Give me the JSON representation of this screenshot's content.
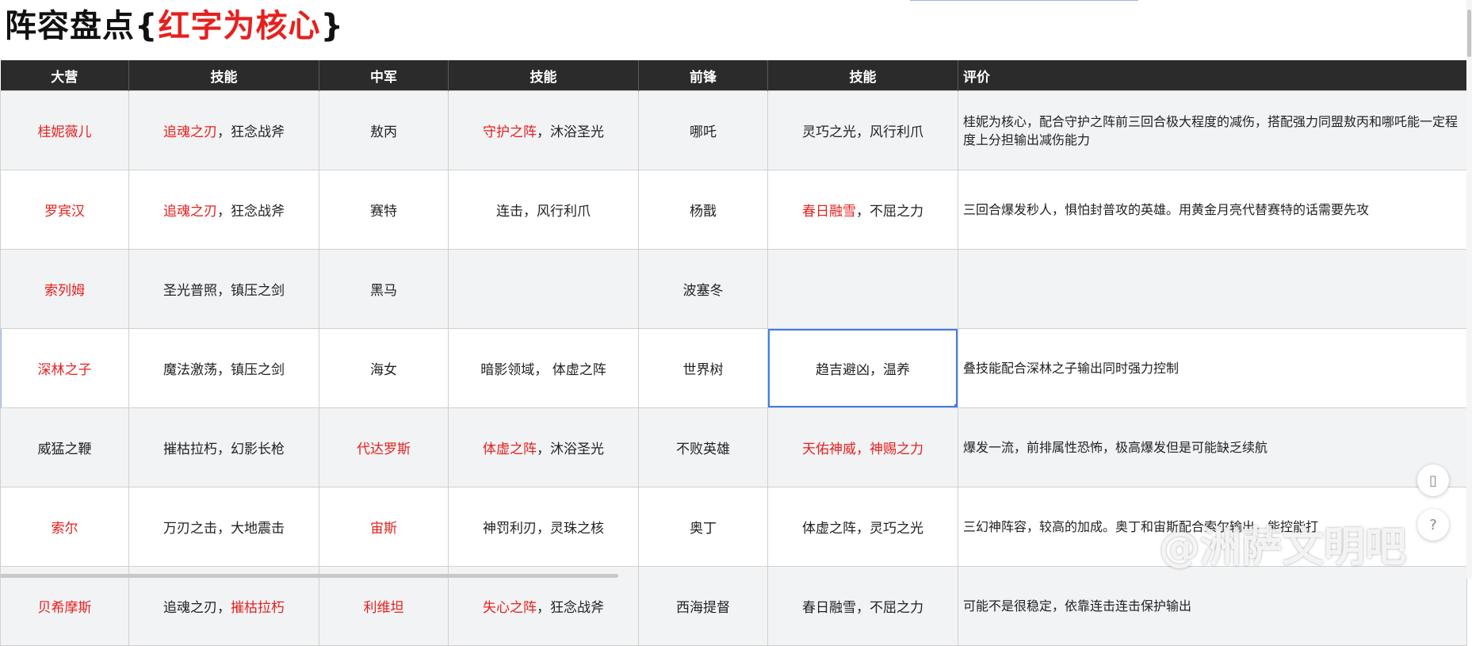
{
  "title": {
    "main": "阵容盘点{",
    "highlight": "红字为核心",
    "end": "}"
  },
  "headers": [
    "大营",
    "技能",
    "中军",
    "技能",
    "前锋",
    "技能",
    "评价"
  ],
  "rows": [
    {
      "c0": [
        {
          "t": "桂妮薇儿",
          "red": true
        }
      ],
      "c1": [
        {
          "t": "追魂之刃",
          "red": true
        },
        {
          "t": "，狂念战斧",
          "red": false
        }
      ],
      "c2": [
        {
          "t": "敖丙",
          "red": false
        }
      ],
      "c3": [
        {
          "t": "守护之阵",
          "red": true
        },
        {
          "t": "，沐浴圣光",
          "red": false
        }
      ],
      "c4": [
        {
          "t": "哪吒",
          "red": false
        }
      ],
      "c5": [
        {
          "t": "灵巧之光，风行利爪",
          "red": false
        }
      ],
      "eval": "桂妮为核心，配合守护之阵前三回合极大程度的减伤，搭配强力同盟敖丙和哪吒能一定程度上分担输出减伤能力"
    },
    {
      "c0": [
        {
          "t": "罗宾汉",
          "red": true
        }
      ],
      "c1": [
        {
          "t": "追魂之刃",
          "red": true
        },
        {
          "t": "，狂念战斧",
          "red": false
        }
      ],
      "c2": [
        {
          "t": "赛特",
          "red": false
        }
      ],
      "c3": [
        {
          "t": "连击，风行利爪",
          "red": false
        }
      ],
      "c4": [
        {
          "t": "杨戬",
          "red": false
        }
      ],
      "c5": [
        {
          "t": "春日融雪",
          "red": true
        },
        {
          "t": "，不屈之力",
          "red": false
        }
      ],
      "eval": "三回合爆发秒人，惧怕封普攻的英雄。用黄金月亮代替赛特的话需要先攻"
    },
    {
      "c0": [
        {
          "t": "索列姆",
          "red": true
        }
      ],
      "c1": [
        {
          "t": "圣光普照，镇压之剑",
          "red": false
        }
      ],
      "c2": [
        {
          "t": "黑马",
          "red": false
        }
      ],
      "c3": [],
      "c4": [
        {
          "t": "波塞冬",
          "red": false
        }
      ],
      "c5": [],
      "eval": ""
    },
    {
      "c0": [
        {
          "t": "深林之子",
          "red": true
        }
      ],
      "c1": [
        {
          "t": "魔法激荡，镇压之剑",
          "red": false
        }
      ],
      "c2": [
        {
          "t": "海女",
          "red": false
        }
      ],
      "c3": [
        {
          "t": "暗影领域， 体虚之阵",
          "red": false
        }
      ],
      "c4": [
        {
          "t": "世界树",
          "red": false
        }
      ],
      "c5": [
        {
          "t": "趋吉避凶，温养",
          "red": false
        }
      ],
      "eval": "叠技能配合深林之子输出同时强力控制"
    },
    {
      "c0": [
        {
          "t": "威猛之鞭",
          "red": false
        }
      ],
      "c1": [
        {
          "t": "摧枯拉朽，幻影长枪",
          "red": false
        }
      ],
      "c2": [
        {
          "t": "代达罗斯",
          "red": true
        }
      ],
      "c3": [
        {
          "t": "体虚之阵",
          "red": true
        },
        {
          "t": "，沐浴圣光",
          "red": false
        }
      ],
      "c4": [
        {
          "t": "不败英雄",
          "red": false
        }
      ],
      "c5": [
        {
          "t": "天佑神威，神赐之力",
          "red": true
        }
      ],
      "eval": "爆发一流，前排属性恐怖，极高爆发但是可能缺乏续航"
    },
    {
      "c0": [
        {
          "t": "索尔",
          "red": true
        }
      ],
      "c1": [
        {
          "t": "万刃之击，大地震击",
          "red": false
        }
      ],
      "c2": [
        {
          "t": "宙斯",
          "red": true
        }
      ],
      "c3": [
        {
          "t": "神罚利刃，灵珠之核",
          "red": false
        }
      ],
      "c4": [
        {
          "t": "奥丁",
          "red": false
        }
      ],
      "c5": [
        {
          "t": "体虚之阵，灵巧之光",
          "red": false
        }
      ],
      "eval": "三幻神阵容，较高的加成。奥丁和宙斯配合索尔输出，能控能打"
    },
    {
      "c0": [
        {
          "t": "贝希摩斯",
          "red": true
        }
      ],
      "c1": [
        {
          "t": "追魂之刃，",
          "red": false
        },
        {
          "t": "摧枯拉朽",
          "red": true
        }
      ],
      "c2": [
        {
          "t": "利维坦",
          "red": true
        }
      ],
      "c3": [
        {
          "t": "失心之阵",
          "red": true
        },
        {
          "t": "，狂念战斧",
          "red": false
        }
      ],
      "c4": [
        {
          "t": "西海提督",
          "red": false
        }
      ],
      "c5": [
        {
          "t": "春日融雪，不屈之力",
          "red": false
        }
      ],
      "eval": "可能不是很稳定，依靠连击连击保护输出"
    }
  ],
  "colors": {
    "header_bg": "#2b2b2b",
    "core_red": "#e6201e",
    "selection_blue": "#3f7ee6"
  },
  "watermark": "@洲萨文明吧",
  "float_buttons": [
    "tablet-icon",
    "help-icon"
  ]
}
